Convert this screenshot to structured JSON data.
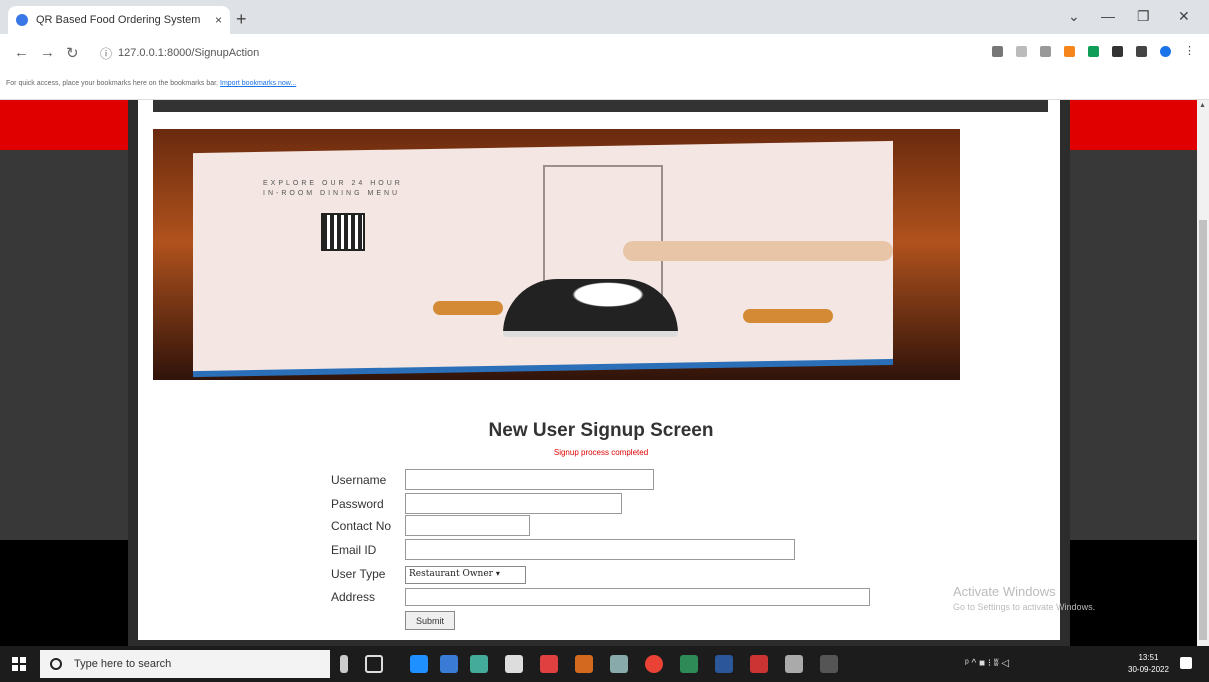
{
  "browser": {
    "tab_title": "QR Based Food Ordering System",
    "tab_close": "×",
    "new_tab": "+",
    "url": "127.0.0.1:8000/SignupAction",
    "win_minimize": "—",
    "win_maximize": "❐",
    "win_close": "✕",
    "win_dropdown": "⌄",
    "bookmarks_text": "For quick access, place your bookmarks here on the bookmarks bar.",
    "bookmarks_link": "Import bookmarks now..."
  },
  "hero": {
    "menu_text": "EXPLORE OUR 24 HOUR IN-ROOM DINING MENU"
  },
  "form": {
    "title": "New User Signup Screen",
    "status": "Signup process completed",
    "username_label": "Username",
    "password_label": "Password",
    "contact_label": "Contact No",
    "email_label": "Email ID",
    "usertype_label": "User Type",
    "usertype_value": "Restaurant Owner",
    "address_label": "Address",
    "submit_label": "Submit"
  },
  "watermark": {
    "line1": "Activate Windows",
    "line2": "Go to Settings to activate Windows."
  },
  "taskbar": {
    "search_placeholder": "Type here to search",
    "time": "13:51",
    "date": "30-09-2022"
  },
  "colors": {
    "red_band": "#e10000",
    "status_red": "#e00000"
  }
}
